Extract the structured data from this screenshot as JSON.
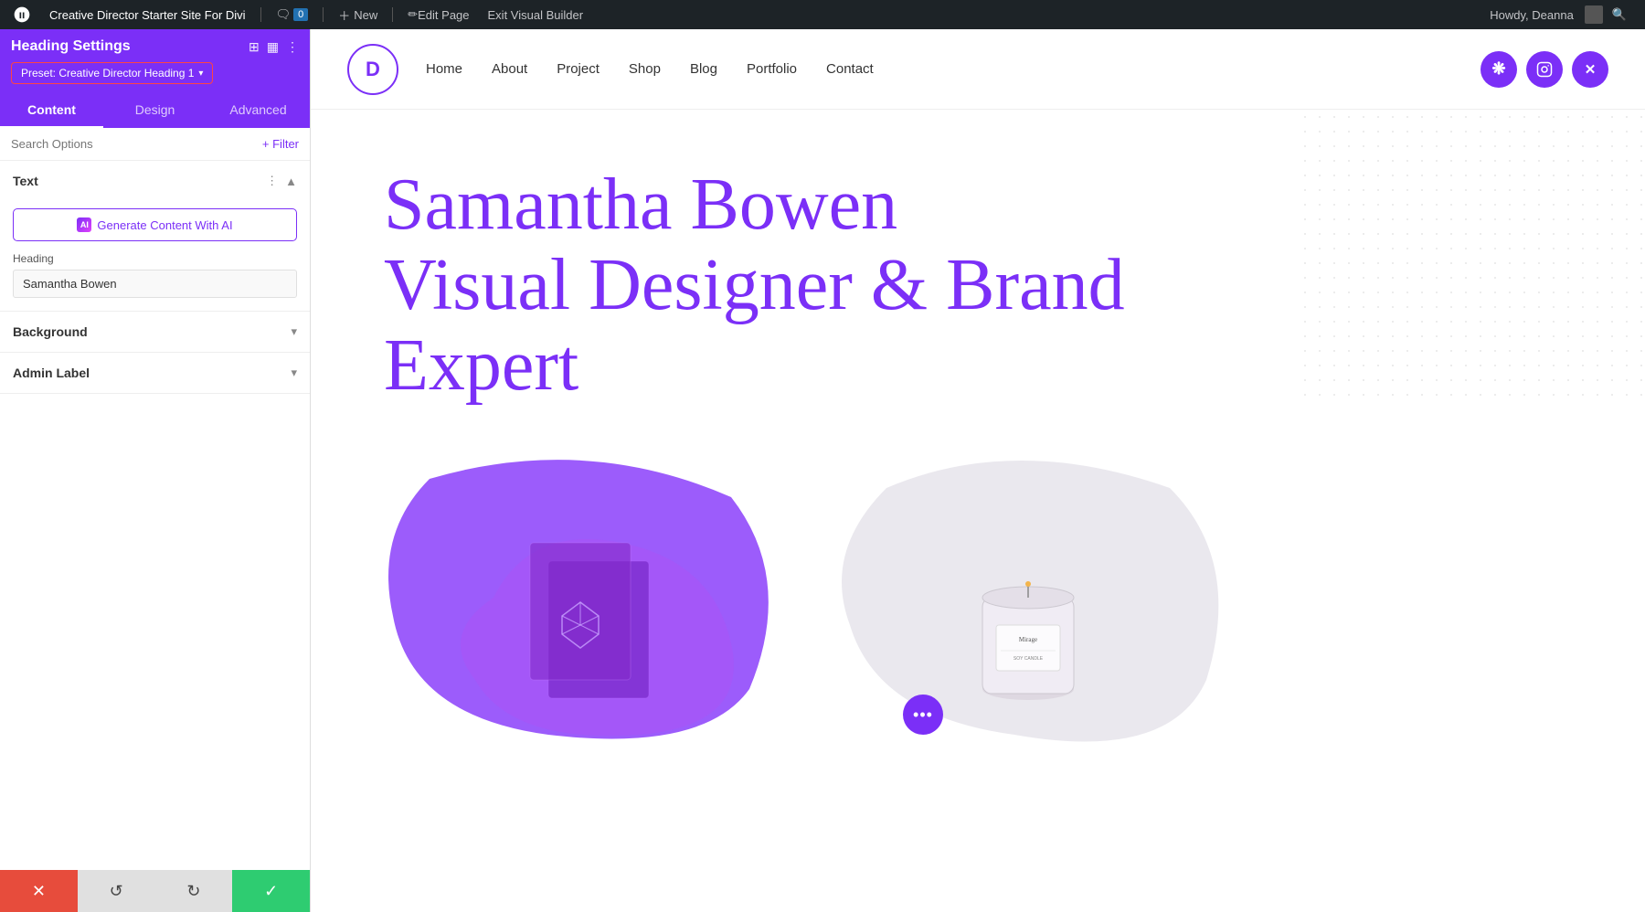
{
  "adminBar": {
    "siteName": "Creative Director Starter Site For Divi",
    "commentCount": "0",
    "newLabel": "New",
    "editPageLabel": "Edit Page",
    "exitBuilderLabel": "Exit Visual Builder",
    "howdy": "Howdy, Deanna",
    "searchIcon": "search",
    "wpIcon": "W"
  },
  "sidebar": {
    "title": "Heading Settings",
    "presetLabel": "Preset: Creative Director Heading 1",
    "tabs": [
      {
        "id": "content",
        "label": "Content",
        "active": true
      },
      {
        "id": "design",
        "label": "Design",
        "active": false
      },
      {
        "id": "advanced",
        "label": "Advanced",
        "active": false
      }
    ],
    "searchPlaceholder": "Search Options",
    "filterLabel": "+ Filter",
    "sections": {
      "text": {
        "title": "Text",
        "expanded": true,
        "aiButton": "Generate Content With AI",
        "headingLabel": "Heading",
        "headingValue": "Samantha Bowen"
      },
      "background": {
        "title": "Background",
        "expanded": false
      },
      "adminLabel": {
        "title": "Admin Label",
        "expanded": false
      }
    },
    "bottomBar": {
      "cancelIcon": "✕",
      "undoIcon": "↺",
      "redoIcon": "↻",
      "saveIcon": "✓"
    }
  },
  "site": {
    "logoLetter": "D",
    "nav": [
      {
        "label": "Home"
      },
      {
        "label": "About"
      },
      {
        "label": "Project"
      },
      {
        "label": "Shop"
      },
      {
        "label": "Blog"
      },
      {
        "label": "Portfolio"
      },
      {
        "label": "Contact"
      }
    ],
    "social": [
      {
        "icon": "❋",
        "name": "dribbble"
      },
      {
        "icon": "📷",
        "name": "instagram"
      },
      {
        "icon": "✕",
        "name": "twitter-x"
      }
    ]
  },
  "hero": {
    "headingLine1": "Samantha Bowen",
    "headingLine2": "Visual Designer & Brand",
    "headingLine3": "Expert",
    "floatingBtnDots": "•••"
  },
  "colors": {
    "primary": "#7b2ff7",
    "heroText": "#7b2ff7",
    "white": "#ffffff",
    "adminBarBg": "#1d2327"
  }
}
